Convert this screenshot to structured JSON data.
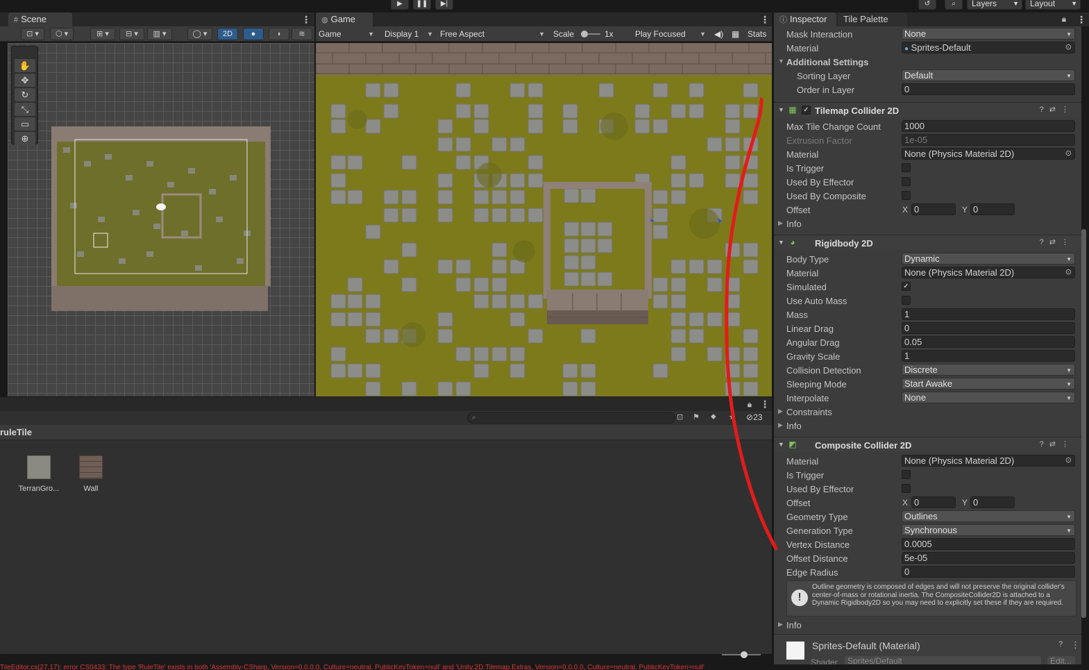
{
  "topbar": {
    "play_icon": "▶",
    "pause_icon": "❚❚",
    "step_icon": "▶|",
    "history_icon": "history-icon",
    "search_icon": "search-icon",
    "layers_label": "Layers",
    "layout_label": "Layout"
  },
  "scene": {
    "tab_label": "Scene",
    "toolbar": {
      "mode_2d": "2D"
    },
    "tools": [
      "hand-tool",
      "move-tool",
      "rotate-tool",
      "scale-tool",
      "rect-tool",
      "transform-tool"
    ]
  },
  "game": {
    "tab_label": "Game",
    "toolbar": {
      "view_select": "Game",
      "display_select": "Display 1",
      "aspect_select": "Free Aspect",
      "scale_label": "Scale",
      "scale_value": "1x",
      "play_mode_select": "Play Focused",
      "stats_label": "Stats"
    }
  },
  "inspector": {
    "tabs": [
      "Inspector",
      "Tile Palette"
    ],
    "top_rows": {
      "mask_interaction": {
        "label": "Mask Interaction",
        "value": "None"
      },
      "material": {
        "label": "Material",
        "value": "Sprites-Default"
      }
    },
    "additional_settings": {
      "label": "Additional Settings",
      "sorting_layer": {
        "label": "Sorting Layer",
        "value": "Default"
      },
      "order_in_layer": {
        "label": "Order in Layer",
        "value": "0"
      }
    },
    "tilemap_collider": {
      "title": "Tilemap Collider 2D",
      "max_tile_change_count": {
        "label": "Max Tile Change Count",
        "value": "1000"
      },
      "extrusion_factor": {
        "label": "Extrusion Factor",
        "value": "1e-05"
      },
      "material": {
        "label": "Material",
        "value": "None (Physics Material 2D)"
      },
      "is_trigger": {
        "label": "Is Trigger"
      },
      "used_by_effector": {
        "label": "Used By Effector"
      },
      "used_by_composite": {
        "label": "Used By Composite"
      },
      "offset": {
        "label": "Offset",
        "x_label": "X",
        "x": "0",
        "y_label": "Y",
        "y": "0"
      },
      "info": "Info"
    },
    "rigidbody": {
      "title": "Rigidbody 2D",
      "body_type": {
        "label": "Body Type",
        "value": "Dynamic"
      },
      "material": {
        "label": "Material",
        "value": "None (Physics Material 2D)"
      },
      "simulated": {
        "label": "Simulated",
        "check": "✓"
      },
      "use_auto_mass": {
        "label": "Use Auto Mass"
      },
      "mass": {
        "label": "Mass",
        "value": "1"
      },
      "linear_drag": {
        "label": "Linear Drag",
        "value": "0"
      },
      "angular_drag": {
        "label": "Angular Drag",
        "value": "0.05"
      },
      "gravity_scale": {
        "label": "Gravity Scale",
        "value": "1"
      },
      "collision_detection": {
        "label": "Collision Detection",
        "value": "Discrete"
      },
      "sleeping_mode": {
        "label": "Sleeping Mode",
        "value": "Start Awake"
      },
      "interpolate": {
        "label": "Interpolate",
        "value": "None"
      },
      "constraints": "Constraints",
      "info": "Info"
    },
    "composite": {
      "title": "Composite Collider 2D",
      "material": {
        "label": "Material",
        "value": "None (Physics Material 2D)"
      },
      "is_trigger": {
        "label": "Is Trigger"
      },
      "used_by_effector": {
        "label": "Used By Effector"
      },
      "offset": {
        "label": "Offset",
        "x_label": "X",
        "x": "0",
        "y_label": "Y",
        "y": "0"
      },
      "geometry_type": {
        "label": "Geometry Type",
        "value": "Outlines"
      },
      "generation_type": {
        "label": "Generation Type",
        "value": "Synchronous"
      },
      "vertex_distance": {
        "label": "Vertex Distance",
        "value": "0.0005"
      },
      "offset_distance": {
        "label": "Offset Distance",
        "value": "5e-05"
      },
      "edge_radius": {
        "label": "Edge Radius",
        "value": "0"
      },
      "help_text": "Outline geometry is composed of edges and will not preserve the original collider's center-of-mass or rotational inertia.  The CompositeCollider2D is attached to a Dynamic Rigidbody2D so you may need to explicitly set these if they are required.",
      "info": "Info"
    },
    "material_footer": {
      "title": "Sprites-Default (Material)",
      "shader_label": "Shader",
      "shader_value": "Sprites/Default",
      "edit_label": "Edit..."
    }
  },
  "project": {
    "breadcrumb": "ruleTile",
    "hidden_count": "23",
    "assets": [
      {
        "name": "TerranGro...",
        "color": "#8a8a80"
      },
      {
        "name": "Wall",
        "color": "#6e5e55"
      }
    ]
  },
  "status_bar": {
    "message": "TileEditor.cs(27,17): error CS0433: The type 'RuleTile' exists in both 'Assembly-CSharp, Version=0.0.0.0, Culture=neutral, PublicKeyToken=null' and 'Unity.2D.Tilemap.Extras, Version=0.0.0.0, Culture=neutral, PublicKeyToken=null'"
  },
  "colors": {
    "grass": "#7d7a1c",
    "stone": "#8c8c88",
    "wall": "#7a6a5f",
    "annotation": "#e31b1b",
    "accent_blue": "#2e5c8a"
  }
}
